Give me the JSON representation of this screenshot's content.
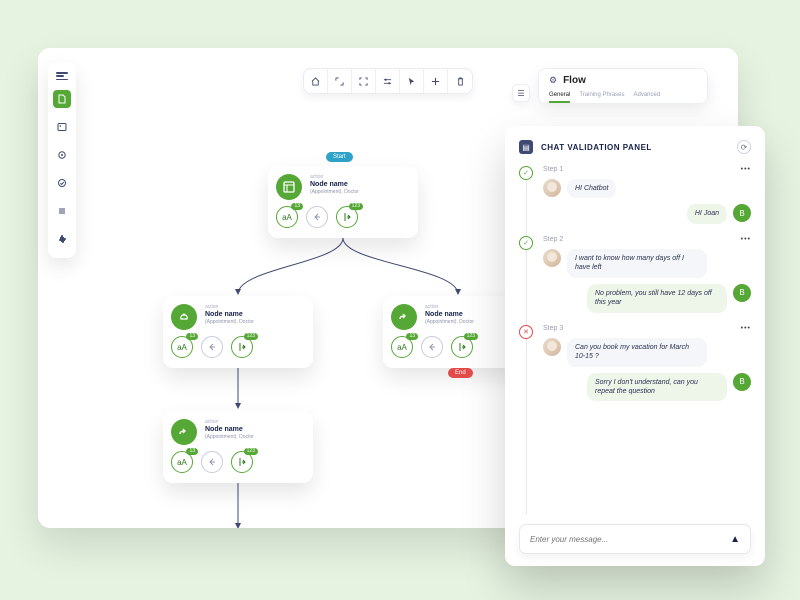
{
  "sidebar": {
    "items": [
      "menu",
      "file",
      "image",
      "target",
      "check",
      "list",
      "puzzle"
    ],
    "activeIndex": 1
  },
  "toolbar": {
    "icons": [
      "home",
      "expand",
      "fullscreen",
      "settings",
      "pointer",
      "plus",
      "trash"
    ]
  },
  "flowcard": {
    "title": "Flow",
    "tabs": [
      "General",
      "Training Phrases",
      "Advanced"
    ],
    "activeTab": 0
  },
  "nodes": {
    "n1": {
      "top": "action",
      "name": "Node name",
      "sub": "(Appointment). Doctor",
      "badge1": "13",
      "badge3": "123"
    },
    "n2": {
      "top": "action",
      "name": "Node name",
      "sub": "(Appointment). Doctor",
      "badge1": "13",
      "badge3": "123"
    },
    "n3": {
      "top": "action",
      "name": "Node name",
      "sub": "(Appointment). Doctor",
      "badge1": "13",
      "badge3": "123"
    },
    "n4": {
      "top": "action",
      "name": "Node name",
      "sub": "(Appointment). Doctor",
      "badge1": "13",
      "badge3": "123"
    }
  },
  "tags": {
    "start": "Start",
    "end": "End"
  },
  "chat": {
    "title": "CHAT VALIDATION PANEL",
    "botInitial": "B",
    "steps": [
      {
        "label": "Step 1",
        "status": "ok",
        "user": "HI Chatbot",
        "bot": "HI Joan"
      },
      {
        "label": "Step 2",
        "status": "ok",
        "user": "I want to know how many days off I have left",
        "bot": "No problem, you still have 12 days off this year"
      },
      {
        "label": "Step 3",
        "status": "err",
        "user": "Can you book my vacation for March 10-15 ?",
        "bot": "Sorry I don't understand, can you repeat the question"
      }
    ],
    "placeholder": "Enter your message..."
  }
}
